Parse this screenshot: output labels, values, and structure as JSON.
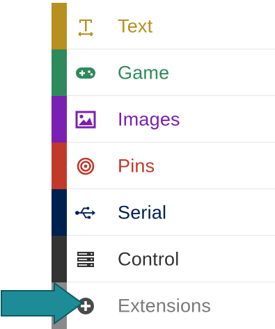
{
  "categories": [
    {
      "key": "text",
      "label": "Text",
      "icon": "text-icon",
      "color": "#b8901f",
      "text_color": "#b8901f"
    },
    {
      "key": "game",
      "label": "Game",
      "icon": "gamepad-icon",
      "color": "#2e8a5b",
      "text_color": "#2e8a5b"
    },
    {
      "key": "images",
      "label": "Images",
      "icon": "image-icon",
      "color": "#7a1fb3",
      "text_color": "#7a1fb3"
    },
    {
      "key": "pins",
      "label": "Pins",
      "icon": "target-icon",
      "color": "#c0392b",
      "text_color": "#c0392b"
    },
    {
      "key": "serial",
      "label": "Serial",
      "icon": "usb-icon",
      "color": "#002050",
      "text_color": "#002050"
    },
    {
      "key": "control",
      "label": "Control",
      "icon": "server-icon",
      "color": "#333333",
      "text_color": "#333333"
    },
    {
      "key": "extensions",
      "label": "Extensions",
      "icon": "add-circle-icon",
      "color": "#8a8a8a",
      "text_color": "#7a7a7a"
    }
  ],
  "arrow_color": "#1e8c96"
}
